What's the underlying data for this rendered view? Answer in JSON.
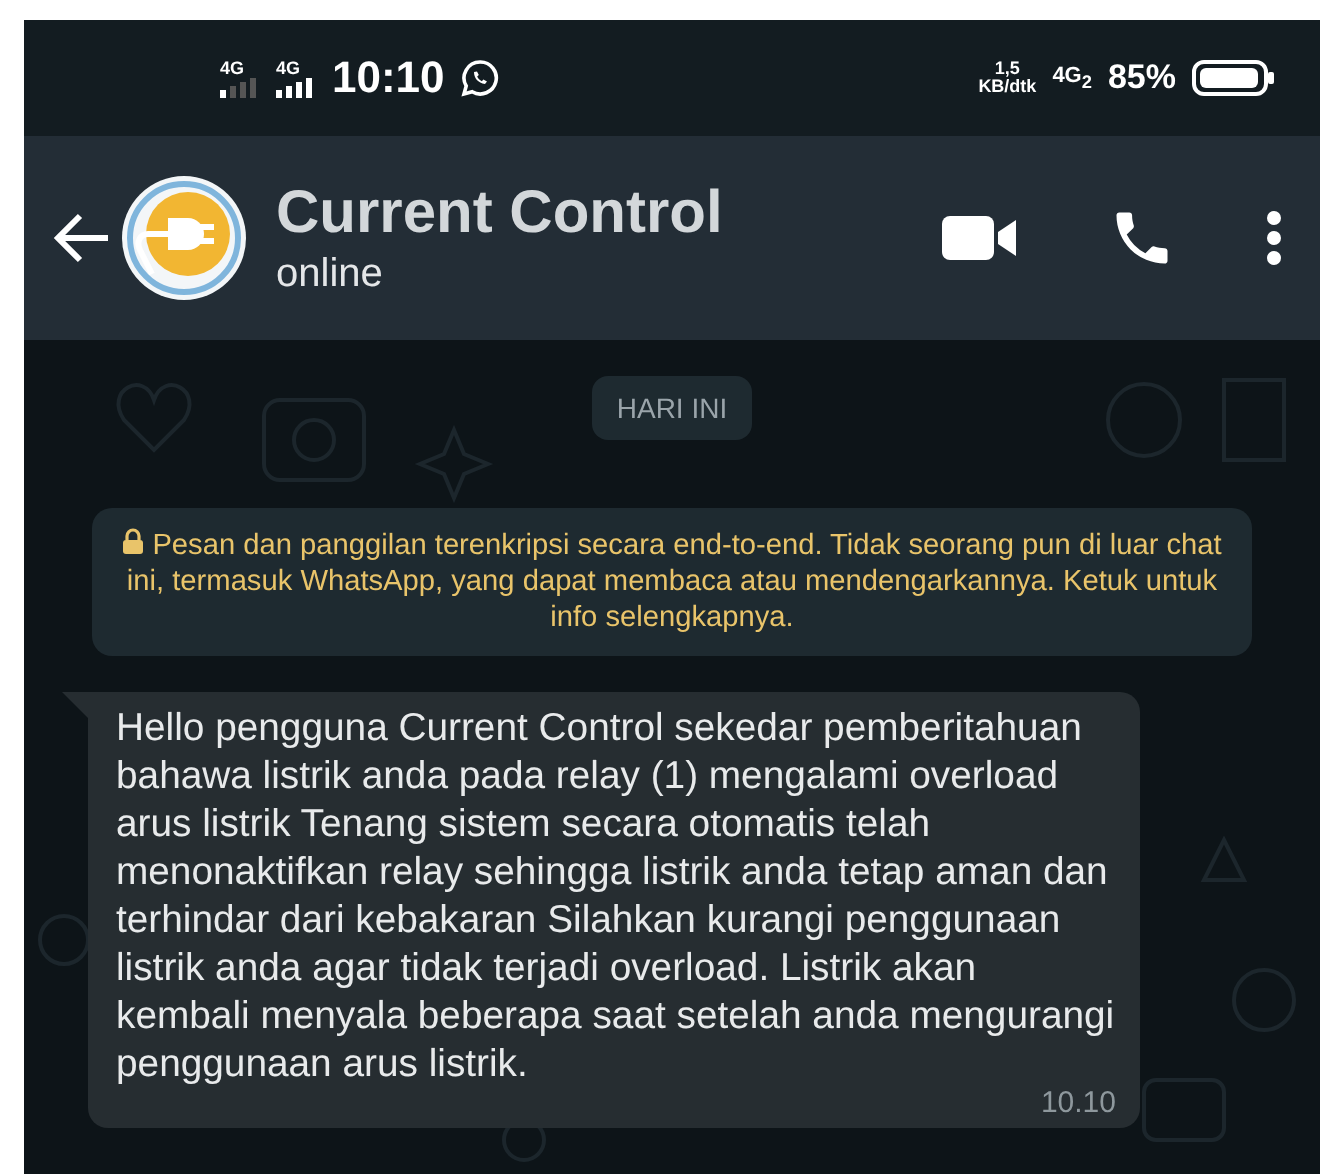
{
  "status_bar": {
    "sim_1": "4G",
    "sim_2": "4G",
    "time": "10:10",
    "speed_value": "1,5",
    "speed_unit": "KB/dtk",
    "network": "4G$_{2}$",
    "battery": "85%"
  },
  "header": {
    "title": "Current Control",
    "subtitle": "online"
  },
  "date_chip": "HARI INI",
  "encryption_notice": "Pesan dan panggilan terenkripsi secara end-to-end. Tidak seorang pun di luar chat ini, termasuk WhatsApp, yang dapat membaca atau mendengarkannya. Ketuk untuk info selengkapnya.",
  "messages": [
    {
      "text": "Hello pengguna Current Control sekedar pemberitahuan bahawa listrik anda pada relay (1) mengalami overload arus listrik Tenang sistem secara otomatis telah menonaktifkan relay sehingga listrik anda tetap aman dan terhindar dari kebakaran Silahkan kurangi penggunaan listrik anda agar tidak terjadi overload. Listrik akan kembali menyala beberapa saat setelah anda mengurangi penggunaan arus listrik.",
      "time": "10.10"
    }
  ]
}
